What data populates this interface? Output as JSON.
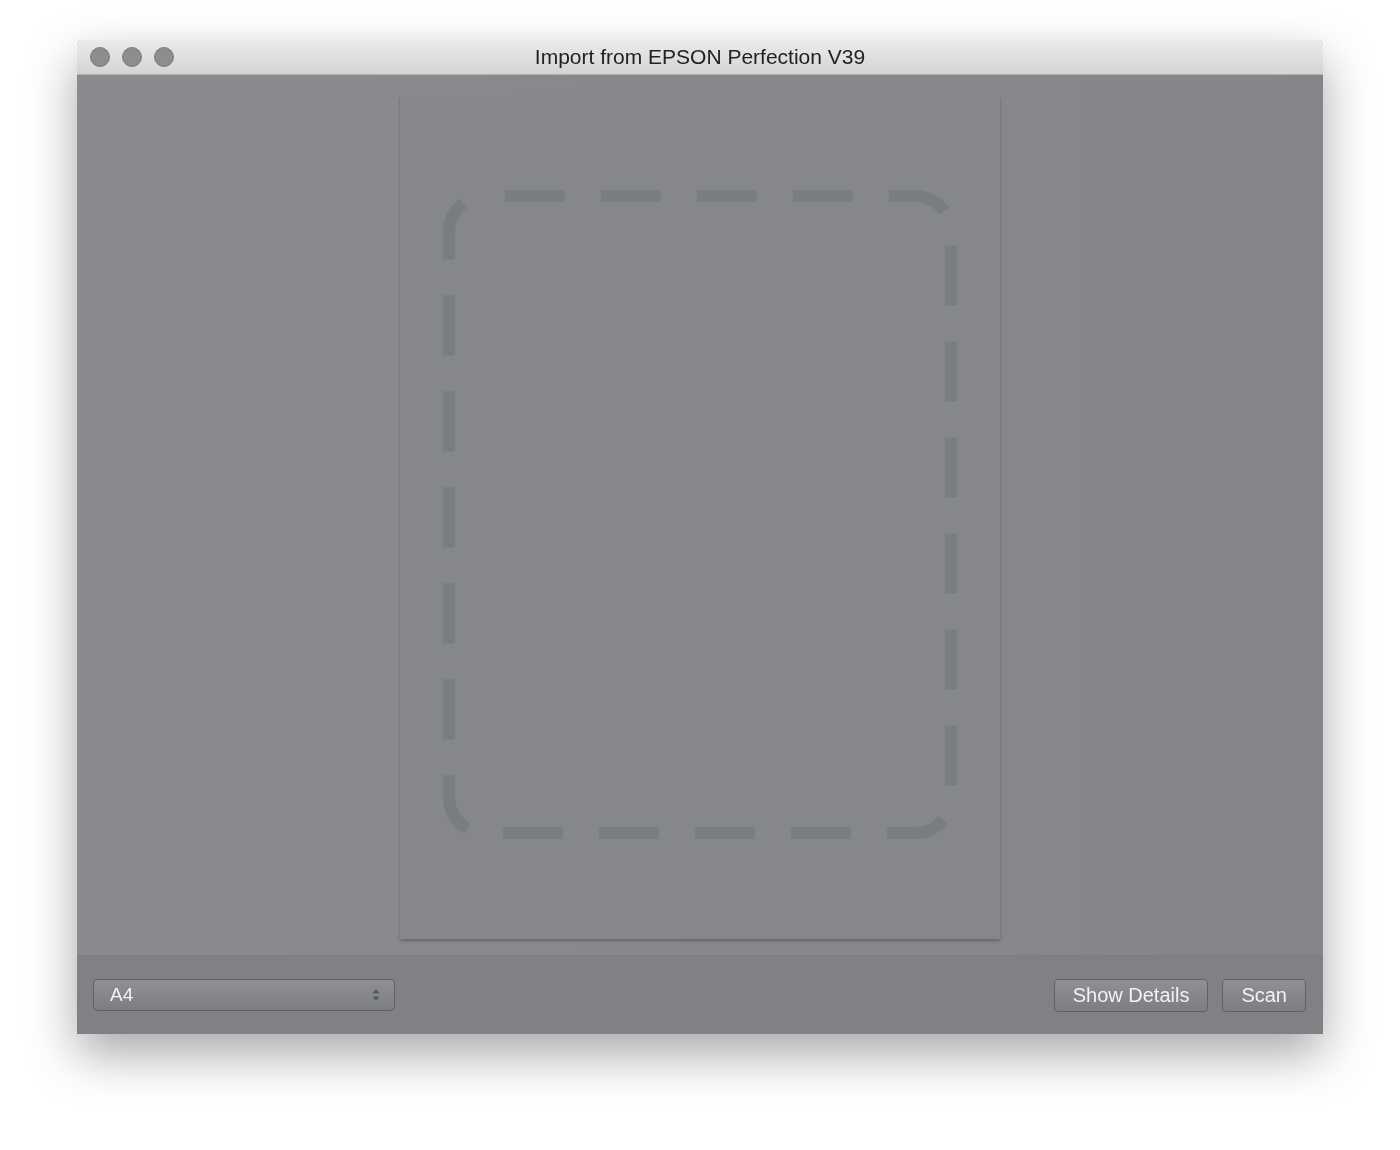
{
  "window": {
    "title": "Import from EPSON Perfection V39",
    "active": false
  },
  "paper_size": {
    "value": "A4"
  },
  "buttons": [
    {
      "label": "Show Details"
    },
    {
      "label": "Scan"
    }
  ]
}
